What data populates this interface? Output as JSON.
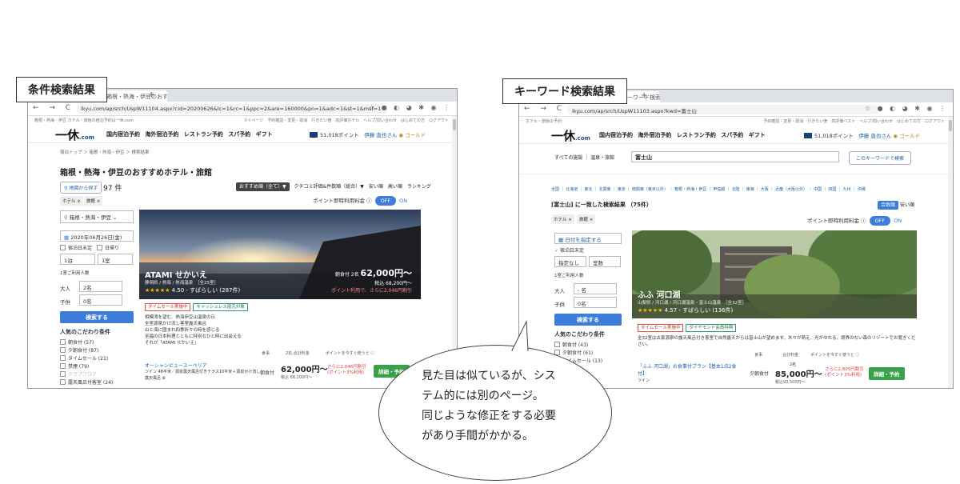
{
  "labels": {
    "left": "条件検索結果",
    "right": "キーワード検索結果"
  },
  "callout": {
    "lines": [
      "見た目は似ているが、シス",
      "テム的には別のページ。",
      "同じような修正をする必要",
      "があり手間がかかる。"
    ]
  },
  "left_window": {
    "tab_title": "箱根・熱海・伊豆のおす",
    "tab_close": "×",
    "new_tab": "+",
    "nav_icons": "← → C ⌂",
    "url": "ikyu.com/ap/srch/UspW11104.aspx?cid=20200626&lc=1&rc=1&ppc=2&are=160000&pn=1&adc=1&st=1&msf=1",
    "ext_icons": "☆ ● ◐ ◕ ✱ ◉ ⋮",
    "topnav_left": "箱根・熱海・伊豆 ホテル・旅館の宿泊予約は一休.com",
    "topnav_right": "マイページ　予約確認・変更・取消　行きたい宿　高評価ホテル　ヘルプ/問い合わせ　はじめての方　ログアウト",
    "logo_main": "一休",
    "logo_sub": ".com",
    "main_nav": "国内宿泊予約 海外宿泊予約 レストラン予約 スパ予約 ギフト",
    "points": "51,018ポイント",
    "user": "伊藤 直也さん",
    "rank": "◉ ゴールド",
    "breadcrumb": "宿泊トップ ＞ 箱根・熱海・伊豆 ＞ 検索結果",
    "page_title": "箱根・熱海・伊豆のおすすめホテル・旅館",
    "map_button": "地図から探す",
    "result_count": "97 件",
    "sort_selected": "おすすめ順（全て）▼",
    "sort_options": "クチコミ評価&件数順（総合）▼　安い順　高い順　ランキング",
    "chips": [
      "ホテル ×",
      "旅館 ×"
    ],
    "point_toggle_label": "ポイント即時利用料金 ⓘ",
    "toggle_off": "OFF",
    "toggle_on": "ON",
    "area_select": "箱根・熱海・伊豆",
    "date": "2020年06月26日(金)",
    "undecided": "宿泊日未定",
    "daytrip": "日帰り",
    "nights": "1泊",
    "rooms": "1室",
    "guests_label": "1室ご利用人数",
    "adult_label": "大人",
    "adult_value": "2名",
    "child_label": "子供",
    "child_value": "0名",
    "search_button": "検索する",
    "kodawari_title": "人気のこだわり条件",
    "kodawari": [
      "朝食付 (57)",
      "夕朝食付 (87)",
      "タイムセール (21)",
      "禁煙 (79)",
      "クラブフロア",
      "露天風呂付客室 (24)"
    ],
    "hotel_name": "ATAMI せかいえ",
    "hotel_area": "静岡県 / 熱海 / 熱海温泉　［全25室］",
    "hotel_stars": "★★★★★",
    "hotel_rating": "4.50 - すばらしい (287件)",
    "price_label": "朝食付 2名",
    "price": "62,000円〜",
    "price_tax": "税込 68,200円〜",
    "price_point": "ポイント利用で、さらに2,046円割引",
    "tag_sale": "タイムセール実施中",
    "tag_cashless": "キャッシュレス還元対象",
    "desc_lines": [
      "相模湾を望む、熱海伊豆山温泉の丘",
      "全室源泉かけ流し客室露天風呂",
      "山と海に囲まれ四季折々の時を感じる",
      "至福の日本料理とともに特別なひと時に出会える",
      "それが「ATAMI せかいえ」"
    ],
    "table_head": "食事　　　　2名 合計料金　　　　ポイントを今すぐ使うと ⓘ",
    "plan_name": "オーシャンビュースーペリア",
    "plan_sub": "ツイン 48平米／源泉露天風呂付きテラス10平米＋源泉かけ流し",
    "plan_sub2": "露天風呂 ⊕",
    "plan_meal": "朝食付",
    "plan_price": "62,000円〜",
    "plan_tax": "税込 68,200円〜",
    "plan_red1": "さらに2,046円割引",
    "plan_red2": "(ポイント3%利用)",
    "plan_button": "詳細・予約"
  },
  "right_window": {
    "tab_title": "富士山のキーワード検索",
    "tab_close": "×",
    "new_tab": "+",
    "nav_icons": "← → C ⌂",
    "url": "ikyu.com/ap/srch/UspW11103.aspx?kwd=富士山",
    "ext_icons": "☆ ● ◐ ◕ ✱ ◉ ⋮",
    "topnav_left": "ホテル・旅館の予約",
    "topnav_right": "予約確認・変更・取消　行きたい宿　高評価ベスト　ヘルプ/問い合わせ　はじめての方　ログアウト",
    "logo_main": "一休",
    "logo_sub": ".com",
    "main_nav": "国内宿泊予約 海外宿泊予約 レストラン予約 スパ予約 ギフト",
    "points": "51,018ポイント",
    "user": "伊藤 直也さん",
    "rank": "◉ ゴールド",
    "facility_label": "すべての施設 ｜ 温泉・旅館",
    "keyword_value": "富士山",
    "keyword_button": "このキーワードで検索",
    "regions": "全国 ｜ 北海道 ｜ 東北 ｜ 北関東 ｜ 東京 ｜ 南関東（東京以外） ｜ 箱根・熱海・伊豆 ｜ 甲信越 ｜ 北陸 ｜ 東海 ｜ 大阪 ｜ 近畿（大阪以外） ｜ 中国 ｜ 四国 ｜ 九州 ｜ 沖縄",
    "result_title": "[富士山] に一致した検索結果 （75件）",
    "sort_selected": "合致順",
    "sort_option": "安い順",
    "chips": [
      "ホテル ×",
      "旅館 ×"
    ],
    "point_toggle_label": "ポイント即時利用料金 ⓘ",
    "toggle_off": "OFF",
    "toggle_on": "ON",
    "date": "日付を指定する",
    "undecided": "宿泊日未定",
    "nights": "指定なし",
    "rooms": "室数",
    "guests_label": "1室ご利用人数",
    "adult_label": "大人",
    "adult_value": "- 名",
    "child_label": "子供",
    "child_value": "0名",
    "search_button": "検索する",
    "kodawari_title": "人気のこだわり条件",
    "kodawari": [
      "朝食付 (43)",
      "夕朝食付 (61)",
      "タイムセール (13)"
    ],
    "hotel_name": "ふふ 河口湖",
    "hotel_area": "山梨県 / 河口湖 / 河口湖温泉・富士山温泉　［全32室］",
    "hotel_stars": "★★★★★",
    "hotel_rating": "4.57 - すばらしい (136件)",
    "tag_sale": "タイムセール実施中",
    "tag_diamond": "ダイヤモンド会員特典",
    "desc": "全32室は古家源泉の露天風呂付き客室で自然露天からは富士山が望めます。木々が萌え、光がゆれる、境界のない森のリゾートでお寛ぎください。",
    "table_head": "食事　　　　　合計料金　　　ポイントを今すぐ使うと ⓘ",
    "plan_name": "「ふふ 河口湖」お食事付プラン【基本1泊2食付】",
    "plan_sub": "ツイン",
    "plan_meal": "夕朝食付",
    "plan_guests": "2名",
    "plan_price": "85,000円〜",
    "plan_tax": "税込93,500円〜",
    "plan_red1": "さらに2,805円割引",
    "plan_red2": "(ポイント3%利用)",
    "plan_button": "詳細・予約"
  }
}
